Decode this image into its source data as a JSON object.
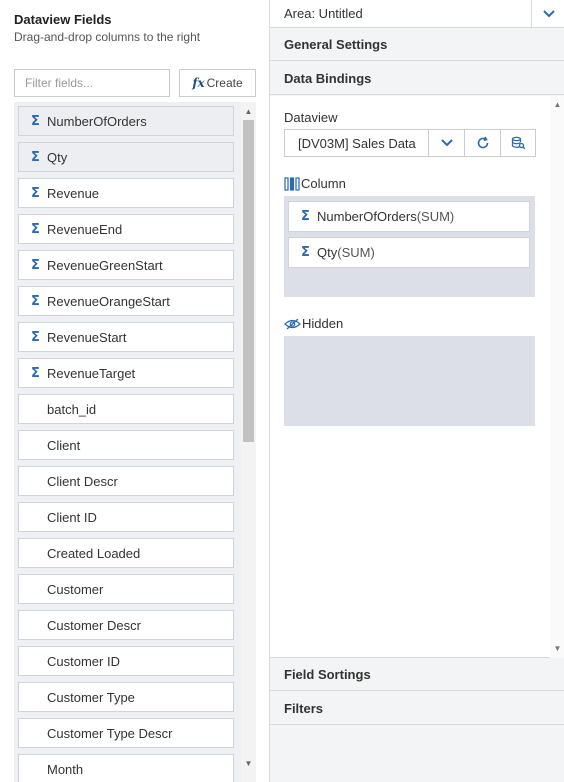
{
  "left": {
    "title": "Dataview Fields",
    "subtitle": "Drag-and-drop columns to the right",
    "filter_placeholder": "Filter fields...",
    "create_label": "Create",
    "create_icon": "fx",
    "fields": [
      {
        "name": "NumberOfOrders",
        "sigma": true,
        "selected": true
      },
      {
        "name": "Qty",
        "sigma": true,
        "selected": true
      },
      {
        "name": "Revenue",
        "sigma": true,
        "selected": false
      },
      {
        "name": "RevenueEnd",
        "sigma": true,
        "selected": false
      },
      {
        "name": "RevenueGreenStart",
        "sigma": true,
        "selected": false
      },
      {
        "name": "RevenueOrangeStart",
        "sigma": true,
        "selected": false
      },
      {
        "name": "RevenueStart",
        "sigma": true,
        "selected": false
      },
      {
        "name": "RevenueTarget",
        "sigma": true,
        "selected": false
      },
      {
        "name": "batch_id",
        "sigma": false,
        "selected": false
      },
      {
        "name": "Client",
        "sigma": false,
        "selected": false
      },
      {
        "name": "Client Descr",
        "sigma": false,
        "selected": false
      },
      {
        "name": "Client ID",
        "sigma": false,
        "selected": false
      },
      {
        "name": "Created Loaded",
        "sigma": false,
        "selected": false
      },
      {
        "name": "Customer",
        "sigma": false,
        "selected": false
      },
      {
        "name": "Customer Descr",
        "sigma": false,
        "selected": false
      },
      {
        "name": "Customer ID",
        "sigma": false,
        "selected": false
      },
      {
        "name": "Customer Type",
        "sigma": false,
        "selected": false
      },
      {
        "name": "Customer Type Descr",
        "sigma": false,
        "selected": false
      },
      {
        "name": "Month",
        "sigma": false,
        "selected": false
      }
    ]
  },
  "right": {
    "area_label": "Area: Untitled",
    "sections": {
      "general": "General Settings",
      "bindings": "Data Bindings",
      "sortings": "Field Sortings",
      "filters": "Filters"
    },
    "dataview_label": "Dataview",
    "dataview_value": "[DV03M] Sales Data",
    "column_label": "Column",
    "columns": [
      {
        "name": "NumberOfOrders",
        "agg": "(SUM)"
      },
      {
        "name": "Qty",
        "agg": "(SUM)"
      }
    ],
    "hidden_label": "Hidden"
  },
  "colors": {
    "accent": "#2a6bb3",
    "zone_bg": "#dcdfe7",
    "panel_bg": "#f3f4f6"
  }
}
